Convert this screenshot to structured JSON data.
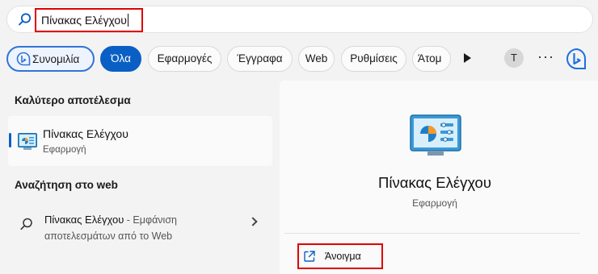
{
  "search": {
    "query": "Πίνακας Ελέγχου"
  },
  "filters": {
    "chat_label": "Συνομιλία",
    "chips": [
      "Όλα",
      "Εφαρμογές",
      "Έγγραφα",
      "Web",
      "Ρυθμίσεις",
      "Άτομ"
    ],
    "active": "Όλα",
    "avatar_initial": "T",
    "more_label": "···"
  },
  "best_match": {
    "heading": "Καλύτερο αποτέλεσμα",
    "name": "Πίνακας Ελέγχου",
    "type": "Εφαρμογή"
  },
  "web_search": {
    "heading": "Αναζήτηση στο web",
    "query": "Πίνακας Ελέγχου",
    "suffix": " - Εμφάνιση αποτελεσμάτων από το Web"
  },
  "detail": {
    "name": "Πίνακας Ελέγχου",
    "type": "Εφαρμογή",
    "open_label": "Άνοιγμα"
  },
  "colors": {
    "accent": "#0a5fc4",
    "highlight_box": "#e00000"
  }
}
